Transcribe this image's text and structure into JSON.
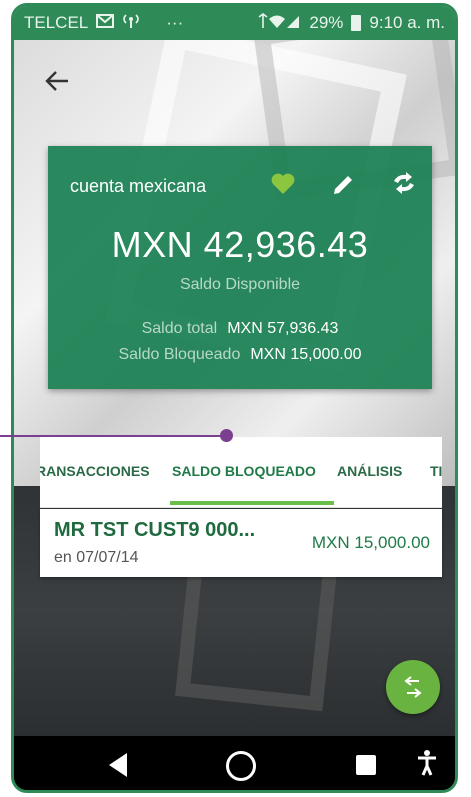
{
  "status_bar": {
    "carrier": "TELCEL",
    "dots": "···",
    "battery": "29%",
    "time": "9:10 a. m."
  },
  "account": {
    "name": "cuenta mexicana",
    "balance": "MXN 42,936.43",
    "balance_label": "Saldo Disponible",
    "total_label": "Saldo total",
    "total_value": "MXN 57,936.43",
    "blocked_label": "Saldo Bloqueado",
    "blocked_value": "MXN 15,000.00"
  },
  "tabs": [
    {
      "label": "RANSACCIONES"
    },
    {
      "label": "SALDO BLOQUEADO",
      "active": true
    },
    {
      "label": "ANÁLISIS"
    },
    {
      "label": "TI"
    }
  ],
  "transaction": {
    "title": "MR TST  CUST9 000...",
    "date": "en 07/07/14",
    "amount": "MXN 15,000.00"
  },
  "colors": {
    "brand_green": "#1a8052",
    "accent_green": "#6abf4b",
    "annotation": "#7b3f8f"
  },
  "icons": {
    "back": "arrow-left-icon",
    "favorite": "heart-icon",
    "edit": "pencil-icon",
    "sync": "sync-icon",
    "transfer": "transfer-arrows-icon"
  }
}
